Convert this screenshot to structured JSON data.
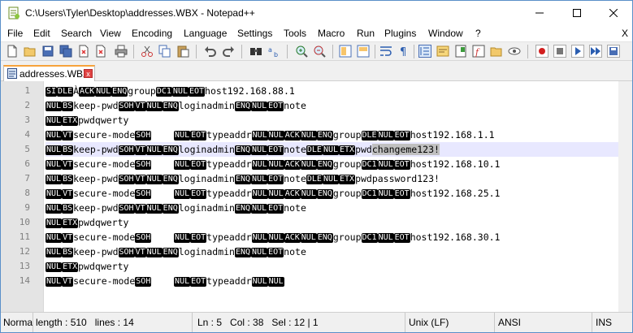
{
  "window": {
    "title": "C:\\Users\\Tyler\\Desktop\\addresses.WBX - Notepad++"
  },
  "menu": [
    "File",
    "Edit",
    "Search",
    "View",
    "Encoding",
    "Language",
    "Settings",
    "Tools",
    "Macro",
    "Run",
    "Plugins",
    "Window",
    "?"
  ],
  "menu_close": "X",
  "toolbar": {
    "icons": [
      "new-file-icon",
      "open-file-icon",
      "save-icon",
      "save-all-icon",
      "close-icon",
      "close-all-icon",
      "print-icon",
      "cut-icon",
      "copy-icon",
      "paste-icon",
      "undo-icon",
      "redo-icon",
      "find-icon",
      "replace-icon",
      "zoom-in-icon",
      "zoom-out-icon",
      "sync-vertical-icon",
      "sync-horizontal-icon",
      "word-wrap-icon",
      "show-all-characters-icon",
      "indent-guide-icon",
      "user-defined-language-icon",
      "document-map-icon",
      "function-list-icon",
      "folder-as-workspace-icon",
      "monitoring-icon",
      "record-macro-icon",
      "stop-record-icon",
      "play-macro-icon",
      "play-macro-multiple-icon",
      "save-macro-icon"
    ]
  },
  "tab": {
    "label": "addresses.WBX",
    "icon": "file-icon",
    "close": "x"
  },
  "editor": {
    "current_line": 5,
    "lines": [
      {
        "n": "1",
        "parts": [
          [
            "c",
            "SI"
          ],
          [
            "c",
            "DLE"
          ],
          [
            "t",
            "À"
          ],
          [
            "c",
            "ACK"
          ],
          [
            "c",
            "NUL"
          ],
          [
            "c",
            "ENQ"
          ],
          [
            "t",
            "group"
          ],
          [
            "c",
            "DC1"
          ],
          [
            "c",
            "NUL"
          ],
          [
            "c",
            "EOT"
          ],
          [
            "t",
            "host192.168.88.1"
          ]
        ]
      },
      {
        "n": "2",
        "parts": [
          [
            "c",
            "NUL"
          ],
          [
            "c",
            "BS"
          ],
          [
            "t",
            "keep-pwd"
          ],
          [
            "c",
            "SOH"
          ],
          [
            "c",
            "VT"
          ],
          [
            "c",
            "NUL"
          ],
          [
            "c",
            "ENQ"
          ],
          [
            "t",
            "loginadmin"
          ],
          [
            "c",
            "ENQ"
          ],
          [
            "c",
            "NUL"
          ],
          [
            "c",
            "EOT"
          ],
          [
            "t",
            "note"
          ]
        ]
      },
      {
        "n": "3",
        "parts": [
          [
            "c",
            "NUL"
          ],
          [
            "c",
            "ETX"
          ],
          [
            "t",
            "pwdqwerty"
          ]
        ]
      },
      {
        "n": "4",
        "parts": [
          [
            "c",
            "NUL"
          ],
          [
            "c",
            "VT"
          ],
          [
            "t",
            "secure-mode"
          ],
          [
            "c",
            "SOH"
          ],
          [
            "t",
            "    "
          ],
          [
            "c",
            "NUL"
          ],
          [
            "c",
            "EOT"
          ],
          [
            "t",
            "typeaddr"
          ],
          [
            "c",
            "NUL"
          ],
          [
            "c",
            "NUL"
          ],
          [
            "c",
            "ACK"
          ],
          [
            "c",
            "NUL"
          ],
          [
            "c",
            "ENQ"
          ],
          [
            "t",
            "group"
          ],
          [
            "c",
            "DLE"
          ],
          [
            "c",
            "NUL"
          ],
          [
            "c",
            "EOT"
          ],
          [
            "t",
            "host192.168.1.1"
          ]
        ]
      },
      {
        "n": "5",
        "parts": [
          [
            "c",
            "NUL"
          ],
          [
            "c",
            "BS"
          ],
          [
            "t",
            "keep-pwd"
          ],
          [
            "c",
            "SOH"
          ],
          [
            "c",
            "VT"
          ],
          [
            "c",
            "NUL"
          ],
          [
            "c",
            "ENQ"
          ],
          [
            "t",
            "loginadmin"
          ],
          [
            "c",
            "ENQ"
          ],
          [
            "c",
            "NUL"
          ],
          [
            "c",
            "EOT"
          ],
          [
            "t",
            "note"
          ],
          [
            "c",
            "DLE"
          ],
          [
            "c",
            "NUL"
          ],
          [
            "c",
            "ETX"
          ],
          [
            "t",
            "pwd"
          ],
          [
            "s",
            "changeme123!"
          ]
        ]
      },
      {
        "n": "6",
        "parts": [
          [
            "c",
            "NUL"
          ],
          [
            "c",
            "VT"
          ],
          [
            "t",
            "secure-mode"
          ],
          [
            "c",
            "SOH"
          ],
          [
            "t",
            "    "
          ],
          [
            "c",
            "NUL"
          ],
          [
            "c",
            "EOT"
          ],
          [
            "t",
            "typeaddr"
          ],
          [
            "c",
            "NUL"
          ],
          [
            "c",
            "NUL"
          ],
          [
            "c",
            "ACK"
          ],
          [
            "c",
            "NUL"
          ],
          [
            "c",
            "ENQ"
          ],
          [
            "t",
            "group"
          ],
          [
            "c",
            "DC1"
          ],
          [
            "c",
            "NUL"
          ],
          [
            "c",
            "EOT"
          ],
          [
            "t",
            "host192.168.10.1"
          ]
        ]
      },
      {
        "n": "7",
        "parts": [
          [
            "c",
            "NUL"
          ],
          [
            "c",
            "BS"
          ],
          [
            "t",
            "keep-pwd"
          ],
          [
            "c",
            "SOH"
          ],
          [
            "c",
            "VT"
          ],
          [
            "c",
            "NUL"
          ],
          [
            "c",
            "ENQ"
          ],
          [
            "t",
            "loginadmin"
          ],
          [
            "c",
            "ENQ"
          ],
          [
            "c",
            "NUL"
          ],
          [
            "c",
            "EOT"
          ],
          [
            "t",
            "note"
          ],
          [
            "c",
            "DLE"
          ],
          [
            "c",
            "NUL"
          ],
          [
            "c",
            "ETX"
          ],
          [
            "t",
            "pwdpassword123!"
          ]
        ]
      },
      {
        "n": "8",
        "parts": [
          [
            "c",
            "NUL"
          ],
          [
            "c",
            "VT"
          ],
          [
            "t",
            "secure-mode"
          ],
          [
            "c",
            "SOH"
          ],
          [
            "t",
            "    "
          ],
          [
            "c",
            "NUL"
          ],
          [
            "c",
            "EOT"
          ],
          [
            "t",
            "typeaddr"
          ],
          [
            "c",
            "NUL"
          ],
          [
            "c",
            "NUL"
          ],
          [
            "c",
            "ACK"
          ],
          [
            "c",
            "NUL"
          ],
          [
            "c",
            "ENQ"
          ],
          [
            "t",
            "group"
          ],
          [
            "c",
            "DC1"
          ],
          [
            "c",
            "NUL"
          ],
          [
            "c",
            "EOT"
          ],
          [
            "t",
            "host192.168.25.1"
          ]
        ]
      },
      {
        "n": "9",
        "parts": [
          [
            "c",
            "NUL"
          ],
          [
            "c",
            "BS"
          ],
          [
            "t",
            "keep-pwd"
          ],
          [
            "c",
            "SOH"
          ],
          [
            "c",
            "VT"
          ],
          [
            "c",
            "NUL"
          ],
          [
            "c",
            "ENQ"
          ],
          [
            "t",
            "loginadmin"
          ],
          [
            "c",
            "ENQ"
          ],
          [
            "c",
            "NUL"
          ],
          [
            "c",
            "EOT"
          ],
          [
            "t",
            "note"
          ]
        ]
      },
      {
        "n": "10",
        "parts": [
          [
            "c",
            "NUL"
          ],
          [
            "c",
            "ETX"
          ],
          [
            "t",
            "pwdqwerty"
          ]
        ]
      },
      {
        "n": "11",
        "parts": [
          [
            "c",
            "NUL"
          ],
          [
            "c",
            "VT"
          ],
          [
            "t",
            "secure-mode"
          ],
          [
            "c",
            "SOH"
          ],
          [
            "t",
            "    "
          ],
          [
            "c",
            "NUL"
          ],
          [
            "c",
            "EOT"
          ],
          [
            "t",
            "typeaddr"
          ],
          [
            "c",
            "NUL"
          ],
          [
            "c",
            "NUL"
          ],
          [
            "c",
            "ACK"
          ],
          [
            "c",
            "NUL"
          ],
          [
            "c",
            "ENQ"
          ],
          [
            "t",
            "group"
          ],
          [
            "c",
            "DC1"
          ],
          [
            "c",
            "NUL"
          ],
          [
            "c",
            "EOT"
          ],
          [
            "t",
            "host192.168.30.1"
          ]
        ]
      },
      {
        "n": "12",
        "parts": [
          [
            "c",
            "NUL"
          ],
          [
            "c",
            "BS"
          ],
          [
            "t",
            "keep-pwd"
          ],
          [
            "c",
            "SOH"
          ],
          [
            "c",
            "VT"
          ],
          [
            "c",
            "NUL"
          ],
          [
            "c",
            "ENQ"
          ],
          [
            "t",
            "loginadmin"
          ],
          [
            "c",
            "ENQ"
          ],
          [
            "c",
            "NUL"
          ],
          [
            "c",
            "EOT"
          ],
          [
            "t",
            "note"
          ]
        ]
      },
      {
        "n": "13",
        "parts": [
          [
            "c",
            "NUL"
          ],
          [
            "c",
            "ETX"
          ],
          [
            "t",
            "pwdqwerty"
          ]
        ]
      },
      {
        "n": "14",
        "parts": [
          [
            "c",
            "NUL"
          ],
          [
            "c",
            "VT"
          ],
          [
            "t",
            "secure-mode"
          ],
          [
            "c",
            "SOH"
          ],
          [
            "t",
            "    "
          ],
          [
            "c",
            "NUL"
          ],
          [
            "c",
            "EOT"
          ],
          [
            "t",
            "typeaddr"
          ],
          [
            "c",
            "NUL"
          ],
          [
            "c",
            "NUL"
          ]
        ]
      }
    ]
  },
  "status": {
    "type": "Norma",
    "length": "length : 510",
    "lines": "lines : 14",
    "ln": "Ln : 5",
    "col": "Col : 38",
    "sel": "Sel : 12 | 1",
    "eol": "Unix (LF)",
    "encoding": "ANSI",
    "mode": "INS"
  },
  "colors": {
    "current_line_bg": "#e8e8ff",
    "tab_accent": "#f7a23b",
    "gutter_bg": "#e4e4e4",
    "selection_bg": "#c0c0c0"
  }
}
